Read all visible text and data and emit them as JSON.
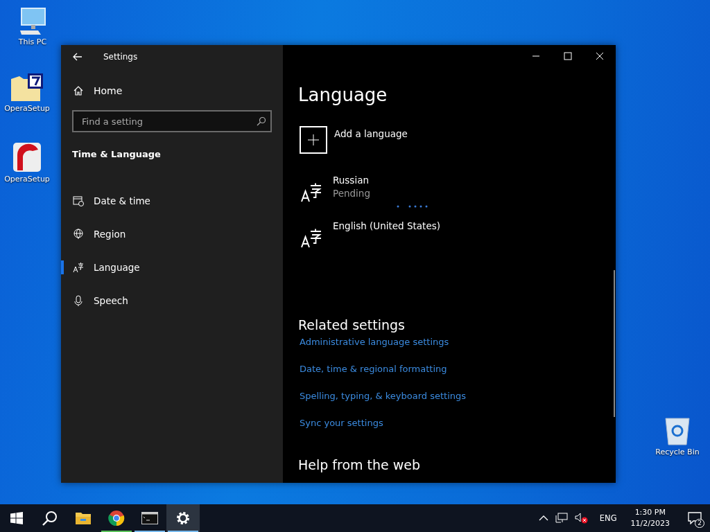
{
  "desktop_icons": [
    {
      "label": "This PC",
      "kind": "pc"
    },
    {
      "label": "OperaSetup",
      "kind": "archive"
    },
    {
      "label": "OperaSetup",
      "kind": "opera"
    },
    {
      "label": "Recycle Bin",
      "kind": "bin"
    }
  ],
  "window": {
    "title": "Settings",
    "sidebar": {
      "home": "Home",
      "search": {
        "placeholder": "Find a setting"
      },
      "section": "Time & Language",
      "items": [
        {
          "label": "Date & time",
          "kind": "calendar",
          "selected": false
        },
        {
          "label": "Region",
          "kind": "globe",
          "selected": false
        },
        {
          "label": "Language",
          "kind": "language",
          "selected": true
        },
        {
          "label": "Speech",
          "kind": "mic",
          "selected": false
        }
      ]
    },
    "content": {
      "heading": "Language",
      "add_language": "Add a language",
      "languages": [
        {
          "name": "Russian",
          "status": "Pending",
          "installing": true
        },
        {
          "name": "English (United States)",
          "installing": false
        }
      ],
      "related_heading": "Related settings",
      "related_links": [
        "Administrative language settings",
        "Date, time & regional formatting",
        "Spelling, typing, & keyboard settings",
        "Sync your settings"
      ],
      "help_heading": "Help from the web"
    }
  },
  "taskbar": {
    "apps": [
      {
        "kind": "explorer",
        "running": false,
        "selected": false
      },
      {
        "kind": "chrome",
        "running": true,
        "selected": false
      },
      {
        "kind": "terminal",
        "running": true,
        "selected": false
      },
      {
        "kind": "settings",
        "running": true,
        "selected": true
      }
    ],
    "language": "ENG",
    "time": "1:30 PM",
    "date": "11/2/2023",
    "notifications": "2"
  }
}
